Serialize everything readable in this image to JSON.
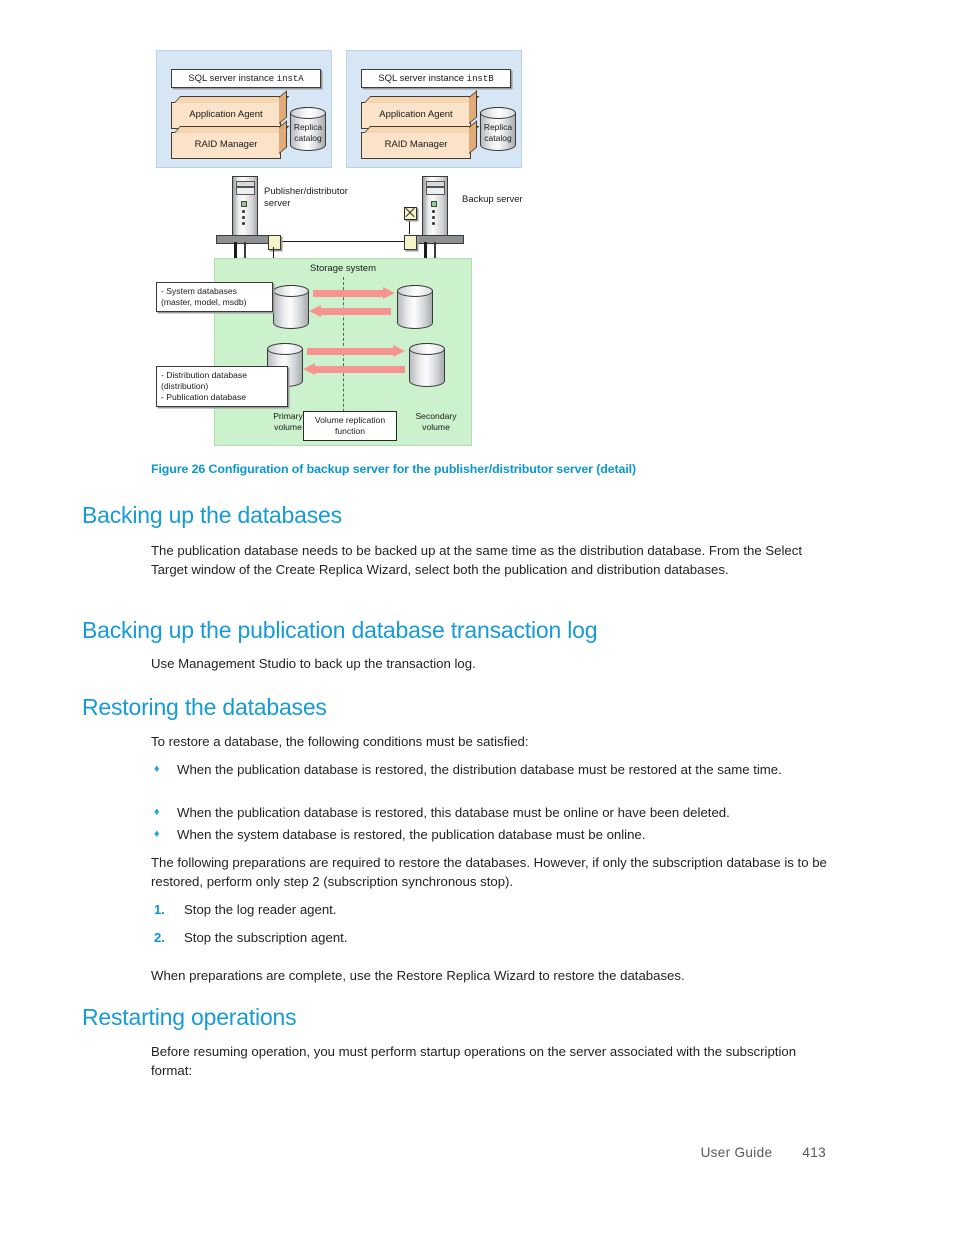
{
  "figure": {
    "caption": "Figure 26 Configuration of backup server for the publisher/distributor server (detail)",
    "instances": [
      {
        "title_prefix": "SQL server instance ",
        "title_mono": "instA",
        "components": [
          "Application Agent",
          "RAID Manager"
        ],
        "catalog_label": "Replica\ncatalog"
      },
      {
        "title_prefix": "SQL server instance ",
        "title_mono": "instB",
        "components": [
          "Application Agent",
          "RAID Manager"
        ],
        "catalog_label": "Replica\ncatalog"
      }
    ],
    "servers": [
      {
        "label": "Publisher/distributor\nserver"
      },
      {
        "label": "Backup server"
      }
    ],
    "storage": {
      "title": "Storage system",
      "callouts": [
        "- System databases\n   (master, model, msdb)",
        "- Distribution database\n(distribution)\n- Publication database"
      ],
      "primary_volume_label": "Primary\nvolume",
      "secondary_volume_label": "Secondary\nvolume",
      "replication_function_label": "Volume replication\nfunction"
    },
    "colors": {
      "instance_panel": "#d6e6f5",
      "component_box": "#fae3c8",
      "storage_panel": "#cbf2cc",
      "arrow": "#f7948f",
      "connector": "#f7f3c9"
    }
  },
  "sections": [
    {
      "heading": "Backing up the databases",
      "paragraphs": [
        "The publication database needs to be backed up at the same time as the distribution database. From the Select Target window of the Create Replica Wizard, select both the publication and distribution databases."
      ]
    },
    {
      "heading": "Backing up the publication database transaction log",
      "paragraphs": [
        "Use Management Studio to back up the transaction log."
      ]
    },
    {
      "heading": "Restoring the databases",
      "intro": "To restore a database, the following conditions must be satisfied:",
      "bullets": [
        "When the publication database is restored, the distribution database must be restored at the same time.",
        "When the publication database is restored, this database must be online or have been deleted.",
        "When the system database is restored, the publication database must be online."
      ],
      "after_bullets": "The following preparations are required to restore the databases. However, if only the subscription database is to be restored, perform only step 2 (subscription synchronous stop).",
      "steps": [
        {
          "marker": "1.",
          "text": "Stop the log reader agent."
        },
        {
          "marker": "2.",
          "text": "Stop the subscription agent."
        }
      ],
      "closing": "When preparations are complete, use the Restore Replica Wizard to restore the databases."
    },
    {
      "heading": "Restarting operations",
      "paragraphs": [
        "Before resuming operation, you must perform startup operations on the server associated with the subscription format:"
      ]
    }
  ],
  "footer": {
    "document_title": "User Guide",
    "page_number": "413"
  },
  "theme": {
    "heading_blue": "#179bd7",
    "caption_blue": "#0b96d4",
    "bullet_blue": "#29a3dc",
    "body_text": "#231f20",
    "footer_gray": "#58595b"
  }
}
